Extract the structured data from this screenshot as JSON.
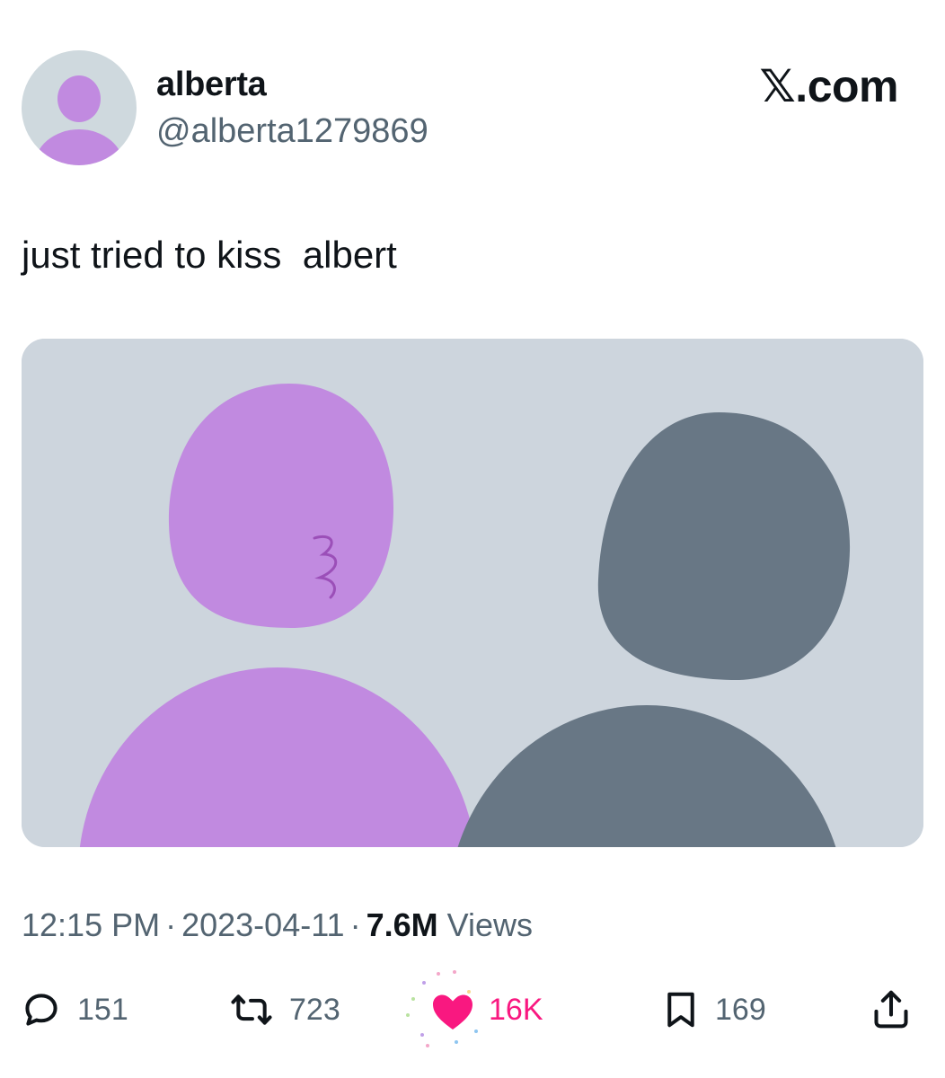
{
  "author": {
    "display_name": "alberta",
    "handle": "@alberta1279869",
    "avatar_icon": "default-avatar-icon",
    "avatar_color": "#c18ae0"
  },
  "brand": "𝕏.com",
  "tweet": {
    "text": "just tried to kiss  albert"
  },
  "media": {
    "description_icon": "avatars-kiss-image",
    "background": "#cdd5dd",
    "purple": "#c18ae0",
    "gray": "#687785"
  },
  "meta": {
    "time": "12:15 PM",
    "separator": "·",
    "date": "2023-04-11",
    "views_count": "7.6M",
    "views_label": "Views"
  },
  "actions": {
    "reply": {
      "icon": "reply-icon",
      "count": "151"
    },
    "repost": {
      "icon": "repost-icon",
      "count": "723"
    },
    "like": {
      "icon": "heart-filled-icon",
      "count": "16K",
      "color": "#f91880",
      "liked": true
    },
    "bookmark": {
      "icon": "bookmark-icon",
      "count": "169"
    },
    "share": {
      "icon": "share-icon"
    }
  }
}
